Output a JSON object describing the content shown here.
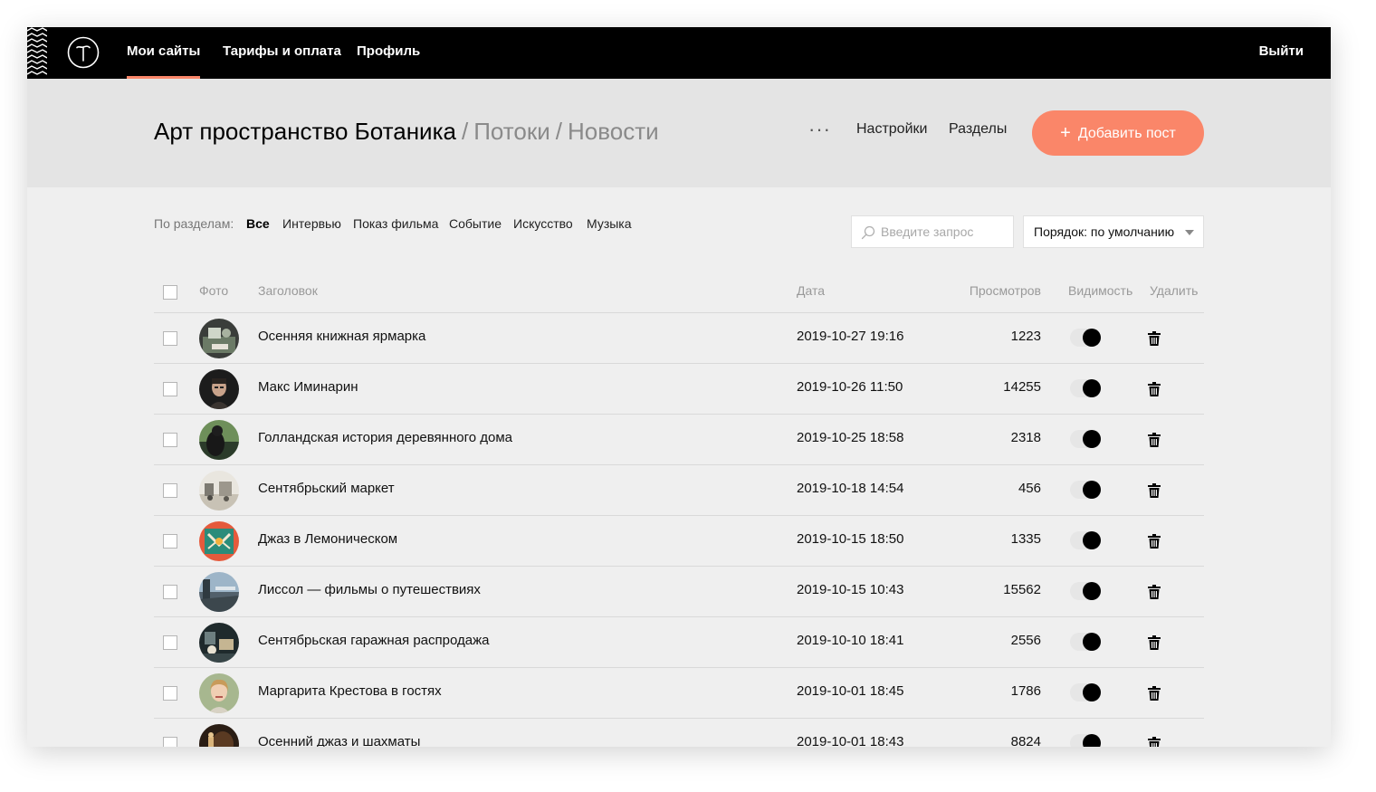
{
  "nav": {
    "items": [
      {
        "label": "Мои сайты",
        "active": true
      },
      {
        "label": "Тарифы и оплата",
        "active": false
      },
      {
        "label": "Профиль",
        "active": false
      }
    ],
    "logout": "Выйти"
  },
  "header": {
    "project": "Арт пространство Ботаника",
    "separator": "/",
    "section": "Потоки",
    "page": "Новости",
    "more": "···",
    "settings": "Настройки",
    "sections": "Разделы",
    "add_plus": "+",
    "add_post": "Добавить пост"
  },
  "filters": {
    "label": "По разделам:",
    "items": [
      "Все",
      "Интервью",
      "Показ фильма",
      "Событие",
      "Искусство",
      "Музыка"
    ],
    "active": "Все"
  },
  "search": {
    "placeholder": "Введите запрос",
    "value": ""
  },
  "order": {
    "label": "Порядок: по умолчанию"
  },
  "table": {
    "columns": {
      "photo": "Фото",
      "title": "Заголовок",
      "date": "Дата",
      "views": "Просмотров",
      "visibility": "Видимость",
      "delete": "Удалить"
    },
    "rows": [
      {
        "title": "Осенняя книжная ярмарка",
        "date": "2019-10-27 19:16",
        "views": "1223",
        "visible": true,
        "photo": "books-photo"
      },
      {
        "title": "Макс Иминарин",
        "date": "2019-10-26 11:50",
        "views": "14255",
        "visible": true,
        "photo": "portrait-man-photo"
      },
      {
        "title": "Голландская история деревянного дома",
        "date": "2019-10-25 18:58",
        "views": "2318",
        "visible": true,
        "photo": "house-photo"
      },
      {
        "title": "Сентябрьский маркет",
        "date": "2019-10-18 14:54",
        "views": "456",
        "visible": true,
        "photo": "market-photo"
      },
      {
        "title": "Джаз в Лемоническом",
        "date": "2019-10-15 18:50",
        "views": "1335",
        "visible": true,
        "photo": "jazz-photo"
      },
      {
        "title": "Лиссол — фильмы о путешествиях",
        "date": "2019-10-15 10:43",
        "views": "15562",
        "visible": true,
        "photo": "travel-photo"
      },
      {
        "title": "Сентябрьская гаражная распродажа",
        "date": "2019-10-10 18:41",
        "views": "2556",
        "visible": true,
        "photo": "garage-sale-photo"
      },
      {
        "title": "Маргарита Крестова в гостях",
        "date": "2019-10-01 18:45",
        "views": "1786",
        "visible": true,
        "photo": "portrait-woman-photo"
      },
      {
        "title": "Осенний джаз и шахматы",
        "date": "2019-10-01 18:43",
        "views": "8824",
        "visible": true,
        "photo": "chess-photo"
      }
    ]
  },
  "colors": {
    "accent": "#fa8669",
    "nav_bg": "#000000",
    "header_bg": "#e4e4e4",
    "page_bg": "#efefef"
  }
}
